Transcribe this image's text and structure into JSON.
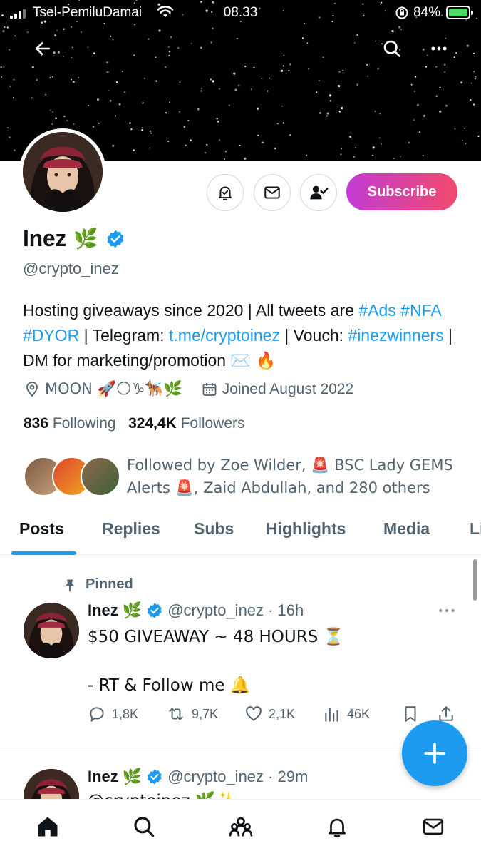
{
  "status_bar": {
    "carrier": "Tsel-PemiluDamai",
    "time": "08.33",
    "battery": "84%"
  },
  "profile": {
    "name": "Inez",
    "name_emoji": "🌿",
    "handle": "@crypto_inez",
    "subscribe_label": "Subscribe",
    "bio": {
      "p1": "Hosting giveaways since 2020 | All tweets are ",
      "tag_ads": "#Ads",
      "tag_nfa": "#NFA",
      "tag_dyor": "#DYOR",
      "p2": " | Telegram: ",
      "telegram_link": "t.me/cryptoinez",
      "p3": " | Vouch: ",
      "tag_winners": "#inezwinners",
      "p4": " | DM for marketing/promotion ✉️ 🔥"
    },
    "location": "MOON 🚀🌕♑🐕‍🦺🌿",
    "joined": "Joined August 2022",
    "following_count": "836",
    "following_label": "Following",
    "followers_count": "324,4K",
    "followers_label": "Followers",
    "followed_by": "Followed by Zoe Wilder, 🚨 BSC Lady GEMS Alerts 🚨, Zaid Abdullah, and 280 others"
  },
  "tabs": [
    {
      "label": "Posts",
      "active": true
    },
    {
      "label": "Replies"
    },
    {
      "label": "Subs"
    },
    {
      "label": "Highlights"
    },
    {
      "label": "Media"
    },
    {
      "label": "Li"
    }
  ],
  "posts": [
    {
      "pinned_label": "Pinned",
      "name": "Inez",
      "name_emoji": "🌿",
      "handle": "@crypto_inez",
      "time": "· 16h",
      "text": "$50 GIVEAWAY ~ 48 HOURS ⏳\n\n- RT & Follow me 🔔",
      "replies": "1,8K",
      "retweets": "9,7K",
      "likes": "2,1K",
      "views": "46K"
    },
    {
      "name": "Inez",
      "name_emoji": "🌿",
      "handle": "@crypto_inez",
      "time": "· 29m",
      "text": "@cryptoinez 🌿✨"
    }
  ],
  "colors": {
    "accent": "#1d9bf0",
    "subscribe_gradient_start": "#c23bd4",
    "subscribe_gradient_end": "#f14b6c",
    "secondary_text": "#536471"
  }
}
